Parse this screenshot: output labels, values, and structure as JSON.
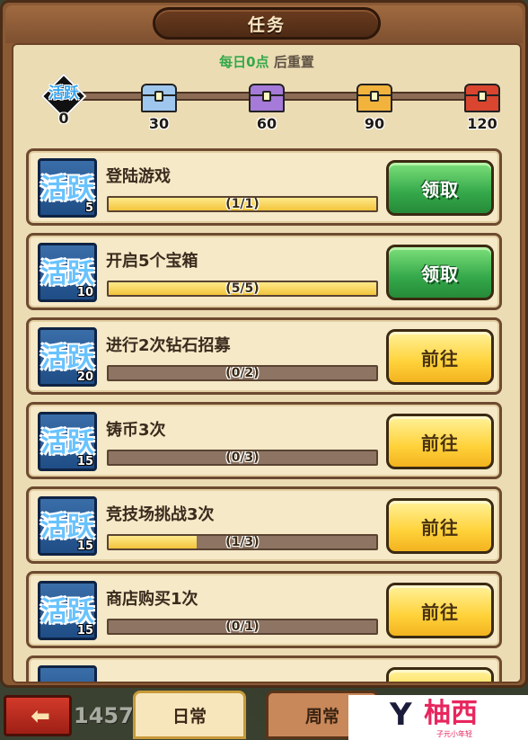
{
  "header": {
    "title": "任务"
  },
  "reset": {
    "time": "每日0点",
    "suffix": "后重置"
  },
  "activity": {
    "glyph": "活跃",
    "current": "0",
    "milestones": [
      {
        "value": "30",
        "icon": "silver-chest-icon",
        "color": "#9fc7ee"
      },
      {
        "value": "60",
        "icon": "purple-chest-icon",
        "color": "#a57ad8"
      },
      {
        "value": "90",
        "icon": "gold-chest-icon",
        "color": "#f2b33c"
      },
      {
        "value": "120",
        "icon": "red-gold-chest-icon",
        "color": "#d9452e"
      }
    ]
  },
  "quests": [
    {
      "title": "登陆游戏",
      "points": "5",
      "progress": "(1/1)",
      "fraction": 1.0,
      "button": "领取",
      "state": "claim"
    },
    {
      "title": "开启5个宝箱",
      "points": "10",
      "progress": "(5/5)",
      "fraction": 1.0,
      "button": "领取",
      "state": "claim"
    },
    {
      "title": "进行2次钻石招募",
      "points": "20",
      "progress": "(0/2)",
      "fraction": 0.0,
      "button": "前往",
      "state": "go"
    },
    {
      "title": "铸币3次",
      "points": "15",
      "progress": "(0/3)",
      "fraction": 0.0,
      "button": "前往",
      "state": "go"
    },
    {
      "title": "竞技场挑战3次",
      "points": "15",
      "progress": "(1/3)",
      "fraction": 0.33,
      "button": "前往",
      "state": "go"
    },
    {
      "title": "商店购买1次",
      "points": "15",
      "progress": "(0/1)",
      "fraction": 0.0,
      "button": "前往",
      "state": "go"
    }
  ],
  "quest_icon_glyph": "活跃",
  "bottom": {
    "back_icon": "back-arrow-icon",
    "peek_number": "1457",
    "tabs": [
      {
        "label": "日常",
        "active": true
      },
      {
        "label": "周常",
        "active": false
      }
    ],
    "watermark": {
      "letter": "Y",
      "name": "柚西",
      "sub": "子元小年轻"
    }
  }
}
